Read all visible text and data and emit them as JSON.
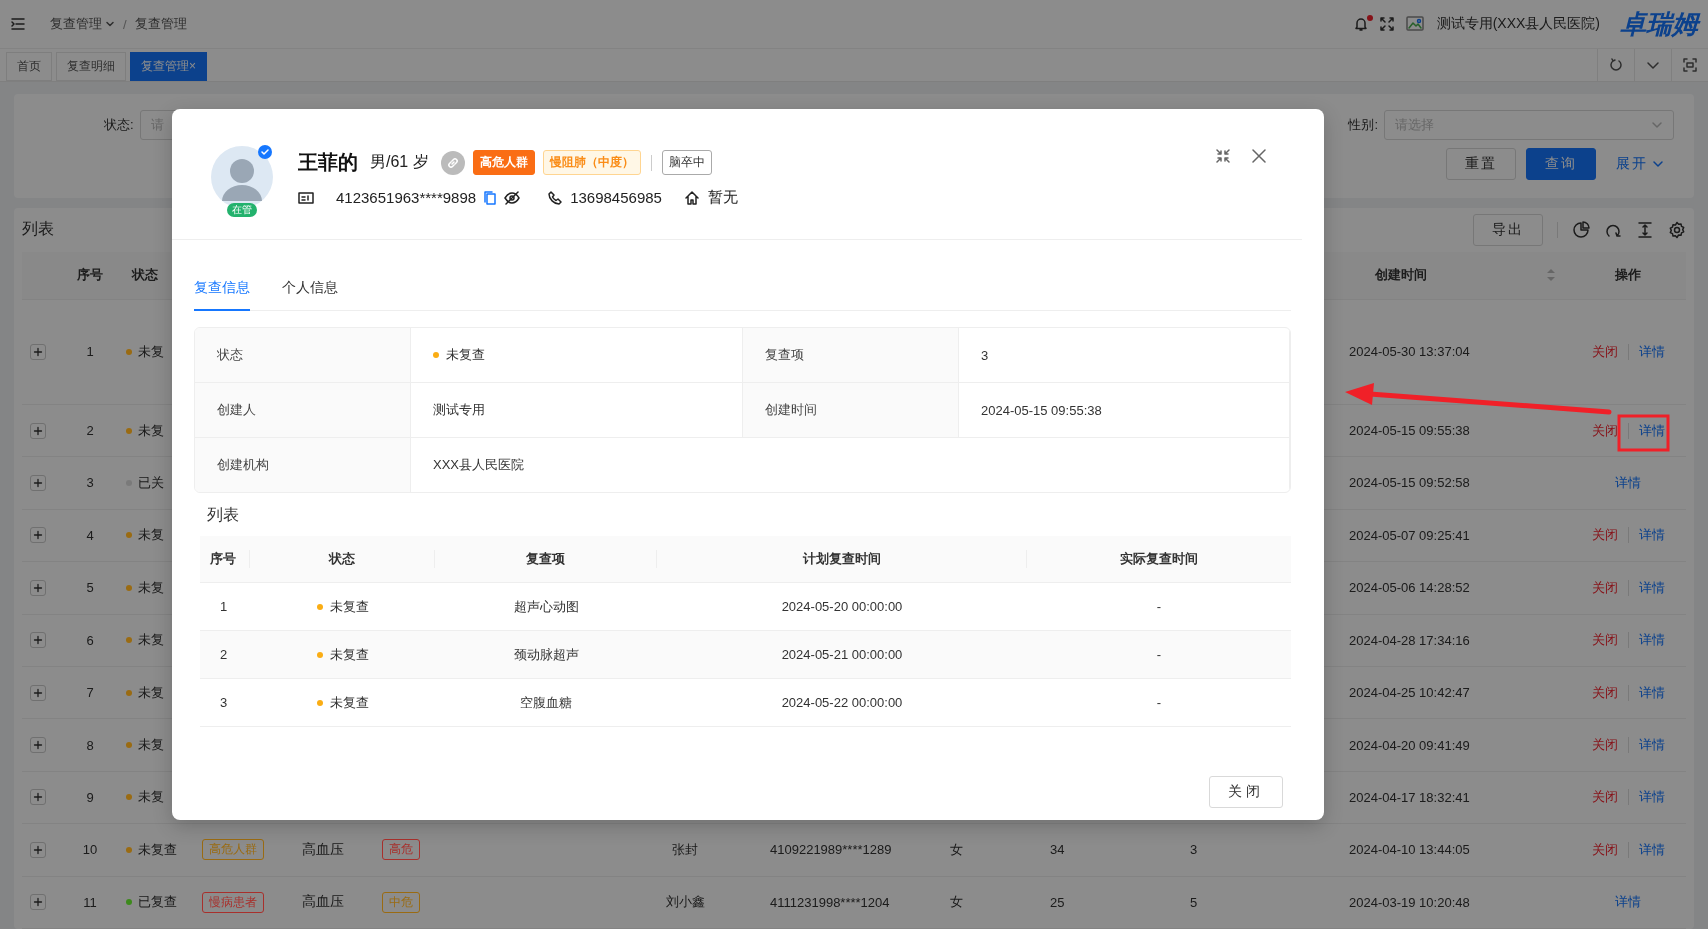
{
  "topbar": {
    "breadcrumb": [
      {
        "label": "复查管理",
        "dropdown": true
      },
      {
        "label": "复查管理",
        "dropdown": false
      }
    ],
    "separator": "/",
    "notification_dot": true,
    "user": "测试专用(XXX县人民医院)",
    "logo": "卓瑞姆"
  },
  "tabs": [
    {
      "label": "首页",
      "selected": false
    },
    {
      "label": "复查明细",
      "selected": false
    },
    {
      "label": "复查管理",
      "selected": true,
      "close": "×"
    }
  ],
  "filters": [
    {
      "label": "状态:",
      "placeholder": "请"
    },
    {
      "label": "性别:",
      "placeholder": "请选择"
    }
  ],
  "filter_buttons": [
    {
      "label": "重置",
      "kind": "default"
    },
    {
      "label": "查询",
      "kind": "primary"
    },
    {
      "label": "展开",
      "kind": "link"
    }
  ],
  "list": {
    "title": "列表",
    "export": "导出",
    "columns": {
      "num": "序号",
      "status": "状态",
      "created": "创建时间",
      "actions": "操作"
    },
    "rows": [
      {
        "num": "1",
        "status": "未复",
        "color": "#9a6b12",
        "created": "2024-05-30 13:37:04",
        "actions": [
          {
            "label": "关闭",
            "kind": "close"
          },
          {
            "label": "详情",
            "kind": "detail"
          }
        ]
      },
      {
        "num": "2",
        "status": "未复",
        "color": "#9a6b12",
        "created": "2024-05-15 09:55:38",
        "actions": [
          {
            "label": "关闭",
            "kind": "close"
          },
          {
            "label": "详情",
            "kind": "detail"
          }
        ]
      },
      {
        "num": "3",
        "status": "已关",
        "color": "#7a7a7a",
        "created": "2024-05-15 09:52:58",
        "actions": [
          {
            "label": "详情",
            "kind": "detail"
          }
        ]
      },
      {
        "num": "4",
        "status": "未复",
        "color": "#9a6b12",
        "created": "2024-05-07 09:25:41",
        "actions": [
          {
            "label": "关闭",
            "kind": "close"
          },
          {
            "label": "详情",
            "kind": "detail"
          }
        ]
      },
      {
        "num": "5",
        "status": "未复",
        "color": "#9a6b12",
        "created": "2024-05-06 14:28:52",
        "actions": [
          {
            "label": "关闭",
            "kind": "close"
          },
          {
            "label": "详情",
            "kind": "detail"
          }
        ]
      },
      {
        "num": "6",
        "status": "未复",
        "color": "#9a6b12",
        "created": "2024-04-28 17:34:16",
        "actions": [
          {
            "label": "关闭",
            "kind": "close"
          },
          {
            "label": "详情",
            "kind": "detail"
          }
        ]
      },
      {
        "num": "7",
        "status": "未复",
        "color": "#9a6b12",
        "created": "2024-04-25 10:42:47",
        "actions": [
          {
            "label": "关闭",
            "kind": "close"
          },
          {
            "label": "详情",
            "kind": "detail"
          }
        ]
      },
      {
        "num": "8",
        "status": "未复",
        "color": "#9a6b12",
        "created": "2024-04-20 09:41:49",
        "actions": [
          {
            "label": "关闭",
            "kind": "close"
          },
          {
            "label": "详情",
            "kind": "detail"
          }
        ]
      },
      {
        "num": "9",
        "status": "未复",
        "color": "#9a6b12",
        "created": "2024-04-17 18:32:41",
        "actions": [
          {
            "label": "关闭",
            "kind": "close"
          },
          {
            "label": "详情",
            "kind": "detail"
          }
        ]
      },
      {
        "num": "10",
        "status": "未复查",
        "color": "#9a6b12",
        "tag": {
          "label": "高危人群",
          "color": "#9a6b12"
        },
        "disease": "高血压",
        "risk": {
          "label": "高危",
          "color": "#a8302c"
        },
        "name": "张封",
        "id_number": "4109221989****1289",
        "sex": "女",
        "age": "34",
        "count": "3",
        "created": "2024-04-10 13:44:05",
        "actions": [
          {
            "label": "关闭",
            "kind": "close"
          },
          {
            "label": "详情",
            "kind": "detail"
          }
        ]
      },
      {
        "num": "11",
        "status": "已复查",
        "color": "#3d8a1c",
        "tag": {
          "label": "慢病患者",
          "color": "#a8302c"
        },
        "disease": "高血压",
        "risk": {
          "label": "中危",
          "color": "#9a6b12"
        },
        "name": "刘小鑫",
        "id_number": "4111231998****1204",
        "sex": "女",
        "age": "25",
        "count": "5",
        "created": "2024-03-19 10:20:48",
        "actions": [
          {
            "label": "详情",
            "kind": "detail"
          }
        ]
      }
    ]
  },
  "modal": {
    "patient": {
      "name": "王菲的",
      "sex_age": "男/61 岁",
      "avatar_badge": "在管",
      "verified": true,
      "tags": [
        {
          "label": "高危人群",
          "kind": "solid"
        },
        {
          "label": "慢阻肺（中度）",
          "kind": "soft"
        },
        {
          "label": "脑卒中",
          "kind": "plain"
        }
      ],
      "id_number": "4123651963****9898",
      "phone": "13698456985",
      "address": "暂无"
    },
    "tabs": [
      {
        "label": "复查信息",
        "selected": true
      },
      {
        "label": "个人信息",
        "selected": false
      }
    ],
    "details": [
      {
        "label": "状态",
        "value": "未复查",
        "color": "#faad14"
      },
      {
        "label": "复查项",
        "value": "3"
      },
      {
        "label": "创建人",
        "value": "测试专用"
      },
      {
        "label": "创建时间",
        "value": "2024-05-15 09:55:38"
      },
      {
        "label": "创建机构",
        "value": "XXX县人民医院"
      }
    ],
    "list_title": "列表",
    "table": {
      "columns": [
        "序号",
        "状态",
        "复查项",
        "计划复查时间",
        "实际复查时间"
      ],
      "rows": [
        {
          "cells": [
            "1",
            "未复查",
            "超声心动图",
            "2024-05-20 00:00:00",
            "-"
          ],
          "color": "#faad14"
        },
        {
          "cells": [
            "2",
            "未复查",
            "颈动脉超声",
            "2024-05-21 00:00:00",
            "-"
          ],
          "color": "#faad14"
        },
        {
          "cells": [
            "3",
            "未复查",
            "空腹血糖",
            "2024-05-22 00:00:00",
            "-"
          ],
          "color": "#faad14"
        }
      ]
    },
    "close_button": "关闭"
  }
}
